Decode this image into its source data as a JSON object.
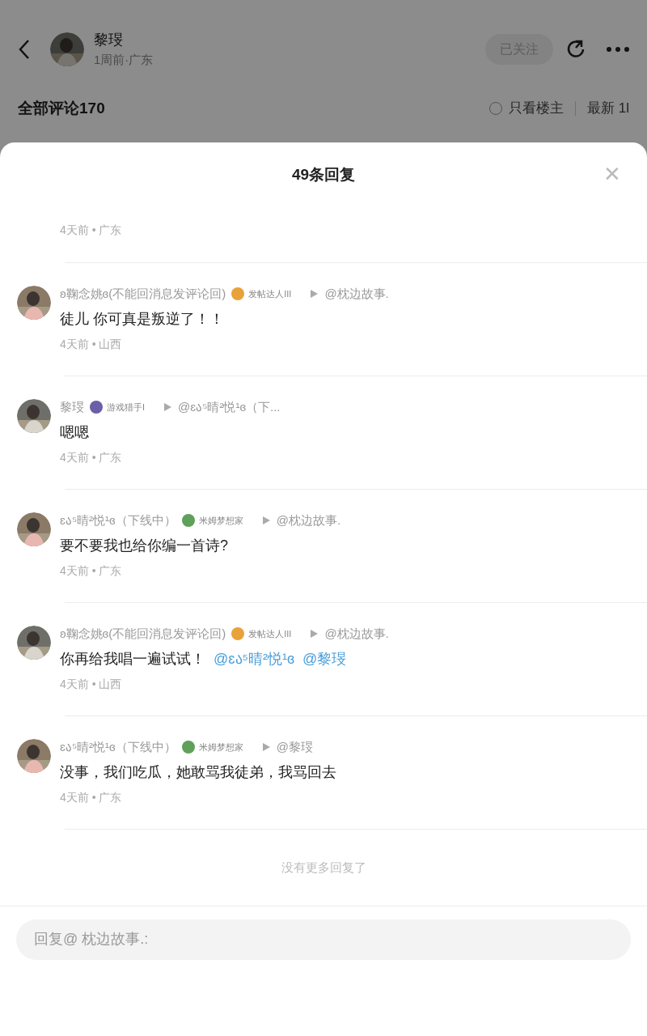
{
  "header": {
    "name": "黎琝",
    "meta": "1周前·广东",
    "follow_button": "已关注"
  },
  "comments_bar": {
    "title": "全部评论170",
    "owner_only": {
      "label": "只看楼主",
      "checked": false
    },
    "sort": "最新 1l"
  },
  "sheet": {
    "title": "49条回复",
    "close": "✕",
    "partial_reply": {
      "meta": "4天前 • 广东"
    },
    "replies": [
      {
        "name": "ʚ鞠念姚ɞ(不能回消息发评论回)",
        "badge": "发帖达人III",
        "color": "#e8a23a",
        "target": "@枕边故事.",
        "body": "徒儿 你可真是叛逆了！！",
        "meta": "4天前 • 山西"
      },
      {
        "name": "黎琝",
        "badge": "游戏猎手I",
        "color": "#6a5fa8",
        "target": "@ɛა⁵晴²悦¹ɞ（下...",
        "body": "嗯嗯",
        "meta": "4天前 • 广东"
      },
      {
        "name": "ɛა⁵晴²悦¹ɞ（下线中）",
        "badge": "米姆梦想家",
        "color": "#5fa05a",
        "target": "@枕边故事.",
        "body": "要不要我也给你编一首诗?",
        "meta": "4天前 • 广东"
      },
      {
        "name": "ʚ鞠念姚ɞ(不能回消息发评论回)",
        "badge": "发帖达人III",
        "color": "#e8a23a",
        "target": "@枕边故事.",
        "body": "你再给我唱一遍试试！",
        "mentions": [
          "@ɛა⁵晴²悦¹ɞ",
          "@黎琝"
        ],
        "meta": "4天前 • 山西"
      },
      {
        "name": "ɛა⁵晴²悦¹ɞ（下线中）",
        "badge": "米姆梦想家",
        "color": "#5fa05a",
        "target": "@黎琝",
        "body": "没事，我们吃瓜，她敢骂我徒弟，我骂回去",
        "meta": "4天前 • 广东"
      }
    ],
    "end_note": "没有更多回复了",
    "reply_field": {
      "placeholder": "回复@ 枕边故事.:"
    }
  }
}
